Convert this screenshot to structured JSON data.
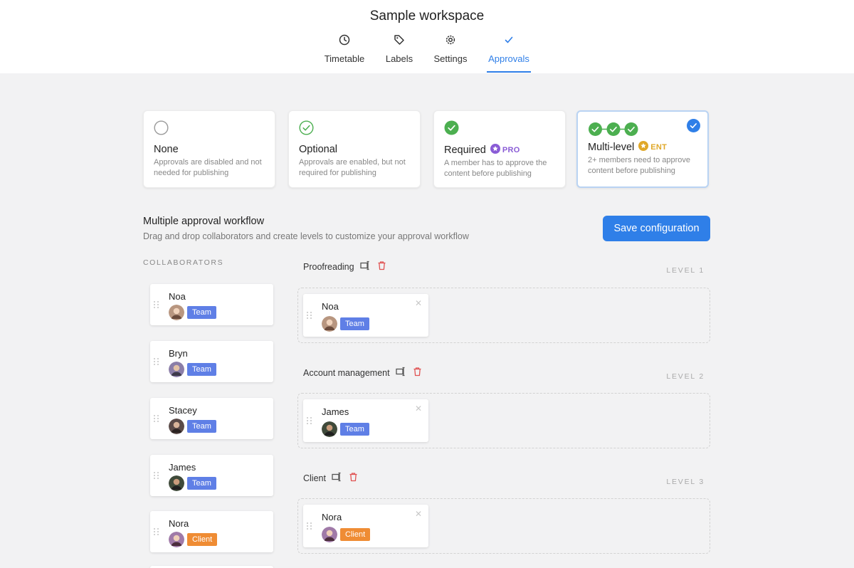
{
  "workspace": {
    "title": "Sample workspace"
  },
  "tabs": [
    {
      "label": "Timetable",
      "icon": "clock-icon"
    },
    {
      "label": "Labels",
      "icon": "tag-icon"
    },
    {
      "label": "Settings",
      "icon": "gear-icon"
    },
    {
      "label": "Approvals",
      "icon": "check-icon",
      "active": true
    }
  ],
  "options": [
    {
      "title": "None",
      "description": "Approvals are disabled and not needed for publishing"
    },
    {
      "title": "Optional",
      "description": "Approvals are enabled, but not required for publishing"
    },
    {
      "title": "Required",
      "badge": "PRO",
      "description": "A member has to approve the content before publishing"
    },
    {
      "title": "Multi-level",
      "badge": "ENT",
      "description": "2+ members need to approve content before publishing",
      "selected": true
    }
  ],
  "workflow": {
    "title": "Multiple approval workflow",
    "subtitle": "Drag and drop collaborators and create levels to customize your approval workflow",
    "save_label": "Save configuration"
  },
  "collaborators": {
    "heading": "COLLABORATORS",
    "items": [
      {
        "name": "Noa",
        "tag": "Team"
      },
      {
        "name": "Bryn",
        "tag": "Team"
      },
      {
        "name": "Stacey",
        "tag": "Team"
      },
      {
        "name": "James",
        "tag": "Team"
      },
      {
        "name": "Nora",
        "tag": "Client"
      }
    ]
  },
  "levels": [
    {
      "name": "Proofreading",
      "label": "LEVEL 1",
      "members": [
        {
          "name": "Noa",
          "tag": "Team"
        }
      ]
    },
    {
      "name": "Account management",
      "label": "LEVEL 2",
      "members": [
        {
          "name": "James",
          "tag": "Team"
        }
      ]
    },
    {
      "name": "Client",
      "label": "LEVEL 3",
      "members": [
        {
          "name": "Nora",
          "tag": "Client"
        }
      ]
    }
  ],
  "colors": {
    "accent": "#2f7fe8",
    "success": "#4caf50",
    "team_tag": "#5f7fe6",
    "client_tag": "#ef8c34",
    "pro": "#8a5cd6",
    "ent": "#e0a829",
    "delete": "#e05252"
  }
}
